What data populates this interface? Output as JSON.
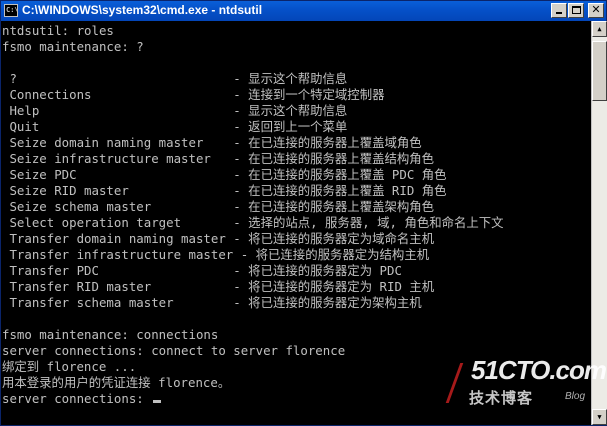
{
  "window": {
    "title": "C:\\WINDOWS\\system32\\cmd.exe - ntdsutil",
    "icon_text": "C:\\"
  },
  "console": {
    "lines": [
      "ntdsutil: roles",
      "fsmo maintenance: ?",
      "",
      " ?                             - 显示这个帮助信息",
      " Connections                   - 连接到一个特定域控制器",
      " Help                          - 显示这个帮助信息",
      " Quit                          - 返回到上一个菜单",
      " Seize domain naming master    - 在已连接的服务器上覆盖域角色",
      " Seize infrastructure master   - 在已连接的服务器上覆盖结构角色",
      " Seize PDC                     - 在已连接的服务器上覆盖 PDC 角色",
      " Seize RID master              - 在已连接的服务器上覆盖 RID 角色",
      " Seize schema master           - 在已连接的服务器上覆盖架构角色",
      " Select operation target       - 选择的站点, 服务器, 域, 角色和命名上下文",
      " Transfer domain naming master - 将已连接的服务器定为域命名主机",
      " Transfer infrastructure master - 将已连接的服务器定为结构主机",
      " Transfer PDC                  - 将已连接的服务器定为 PDC",
      " Transfer RID master           - 将已连接的服务器定为 RID 主机",
      " Transfer schema master        - 将已连接的服务器定为架构主机",
      "",
      "fsmo maintenance: connections",
      "server connections: connect to server florence",
      "绑定到 florence ...",
      "用本登录的用户的凭证连接 florence。",
      "server connections: "
    ],
    "text_color": "#c0c0c0",
    "background": "#000000"
  },
  "watermark": {
    "logo": "51CTO.com",
    "sub": "技术博客",
    "blog": "Blog"
  },
  "colors": {
    "titlebar": "#0550c8",
    "chrome": "#d4d0c8"
  }
}
